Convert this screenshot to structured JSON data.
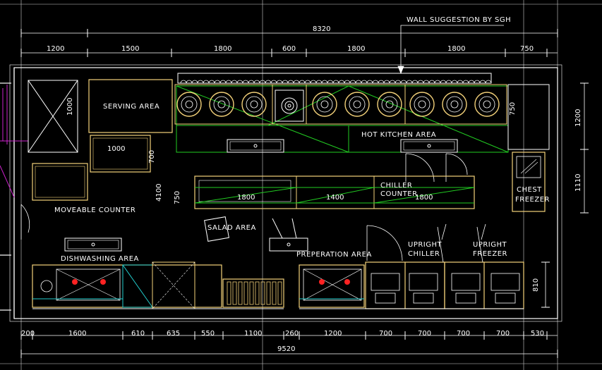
{
  "drawing": {
    "colors": {
      "background": "#000000",
      "wall": "#ffffff",
      "equipment": "#f4d27a",
      "green": "#22cc22",
      "cyan": "#22cccc",
      "magenta": "#cc22cc",
      "red": "#ff2222",
      "dim": "#ffffff"
    },
    "wall_note": "WALL SUGGESTION BY SGH",
    "overall_top": "8320",
    "overall_bottom": "9520",
    "top_dims": [
      "1200",
      "1500",
      "1800",
      "600",
      "1800",
      "1800",
      "750"
    ],
    "bottom_dims": [
      "200",
      "1600",
      "610",
      "635",
      "550",
      "1100",
      "260",
      "1200",
      "700",
      "700",
      "700",
      "700",
      "530"
    ],
    "right_dims": [
      "1200",
      "1110",
      "810"
    ],
    "interior_dims": {
      "d1000v": "1000",
      "d1000h": "1000",
      "d700": "700",
      "d4100": "4100",
      "d750a": "750",
      "d750b": "750",
      "d1800a": "1800",
      "d1400": "1400",
      "d1800b": "1800"
    },
    "labels": {
      "serving": "SERVING AREA",
      "hot_kitchen": "HOT KITCHEN AREA",
      "chiller_counter": [
        "CHILLER",
        "COUNTER"
      ],
      "chest_freezer": [
        "CHEST",
        "FREEZER"
      ],
      "moveable_counter": "MOVEABLE COUNTER",
      "salad": "SALAD AREA",
      "dishwashing": "DISHWASHING AREA",
      "preparation": "PREPERATION AREA",
      "upright_chiller": [
        "UPRIGHT",
        "CHILLER"
      ],
      "upright_freezer": [
        "UPRIGHT",
        "FREEZER"
      ]
    }
  }
}
